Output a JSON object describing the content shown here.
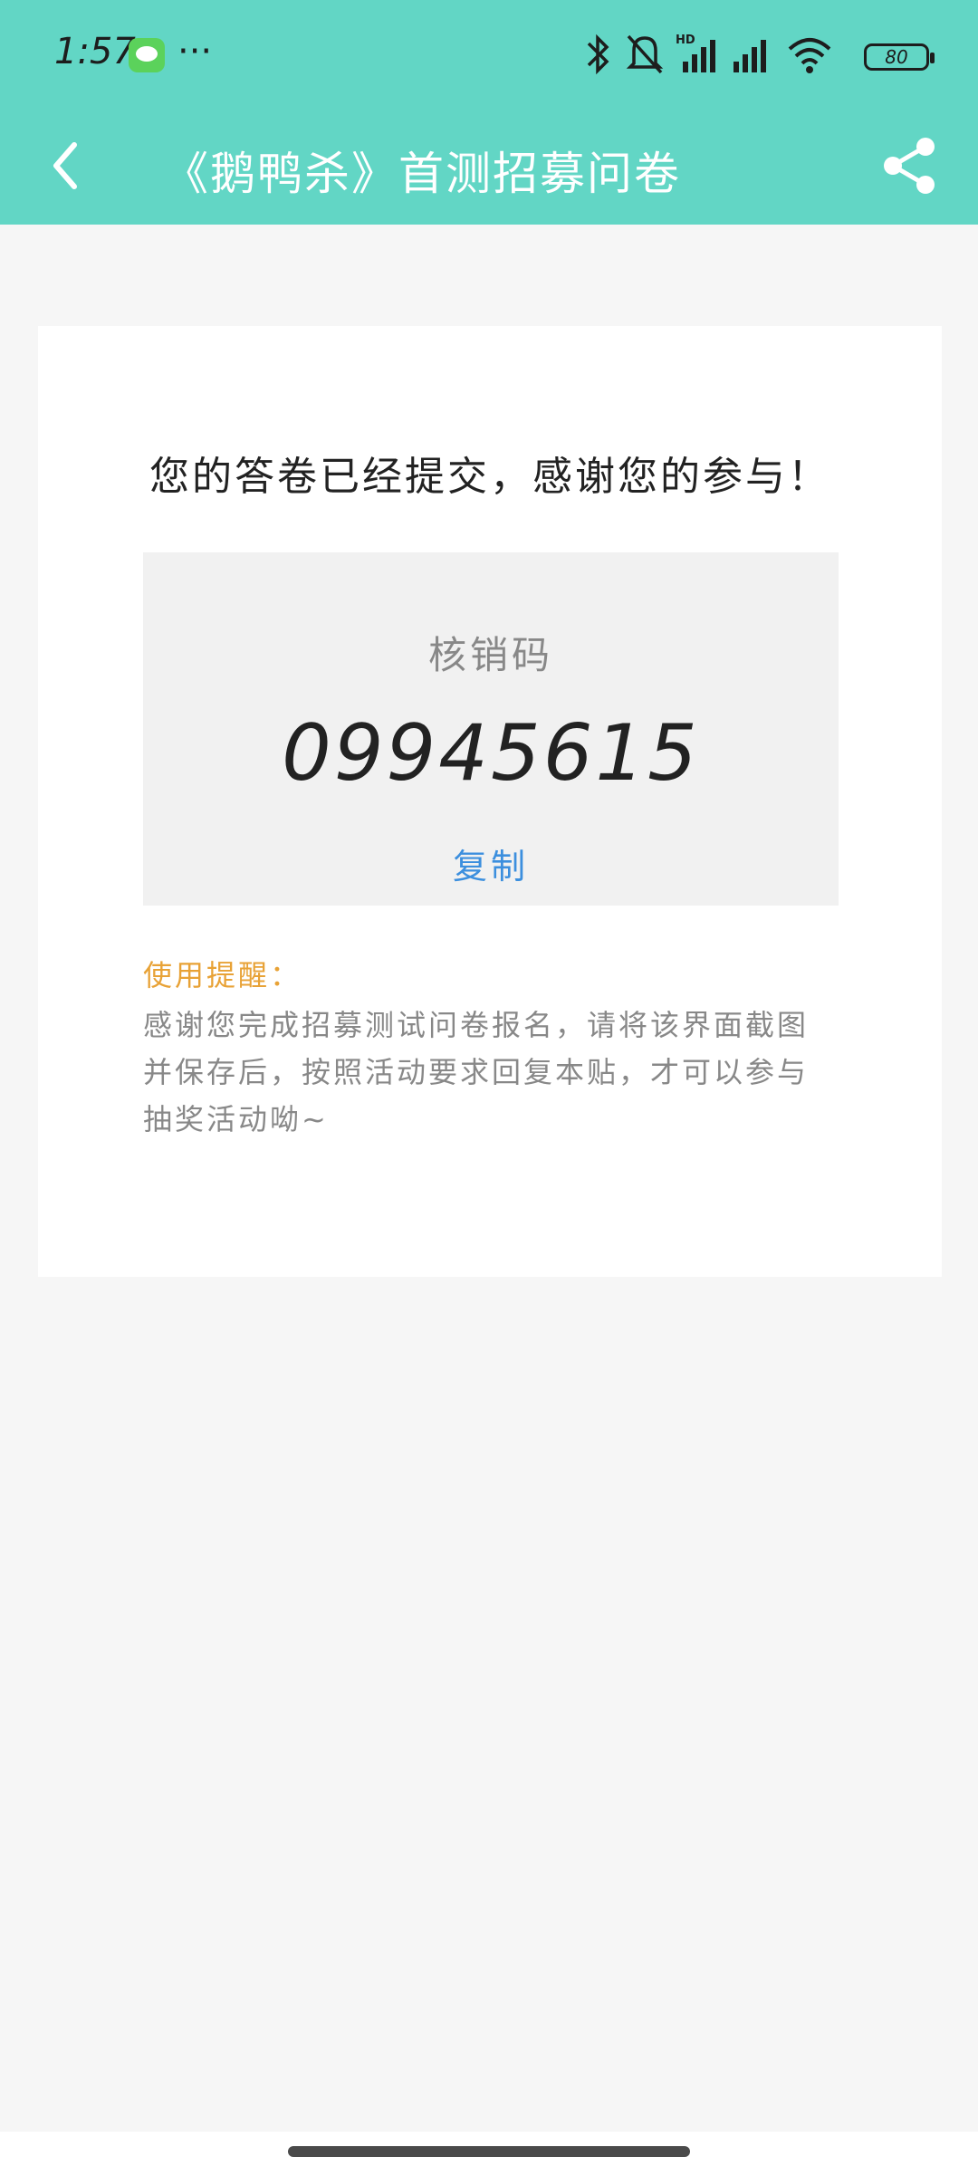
{
  "status_bar": {
    "time": "1:57",
    "more": "···",
    "battery": "80",
    "icons": [
      "wechat-icon",
      "bluetooth-icon",
      "bell-muted-icon",
      "signal-hd-icon",
      "signal-icon",
      "wifi-icon",
      "battery-icon"
    ]
  },
  "navbar": {
    "title": "《鹅鸭杀》首测招募问卷",
    "icons": [
      "back-arrow-icon",
      "share-icon"
    ]
  },
  "result": {
    "message": "您的答卷已经提交，感谢您的参与！",
    "code_label": "核销码",
    "code_value": "09945615",
    "copy_label": "复制"
  },
  "tips": {
    "title": "使用提醒：",
    "body": "感谢您完成招募测试问卷报名，请将该界面截图并保存后，按照活动要求回复本贴，才可以参与抽奖活动呦~"
  },
  "colors": {
    "header": "#62d6c5",
    "copy": "#3c8fde",
    "tip_title": "#e8a236"
  }
}
